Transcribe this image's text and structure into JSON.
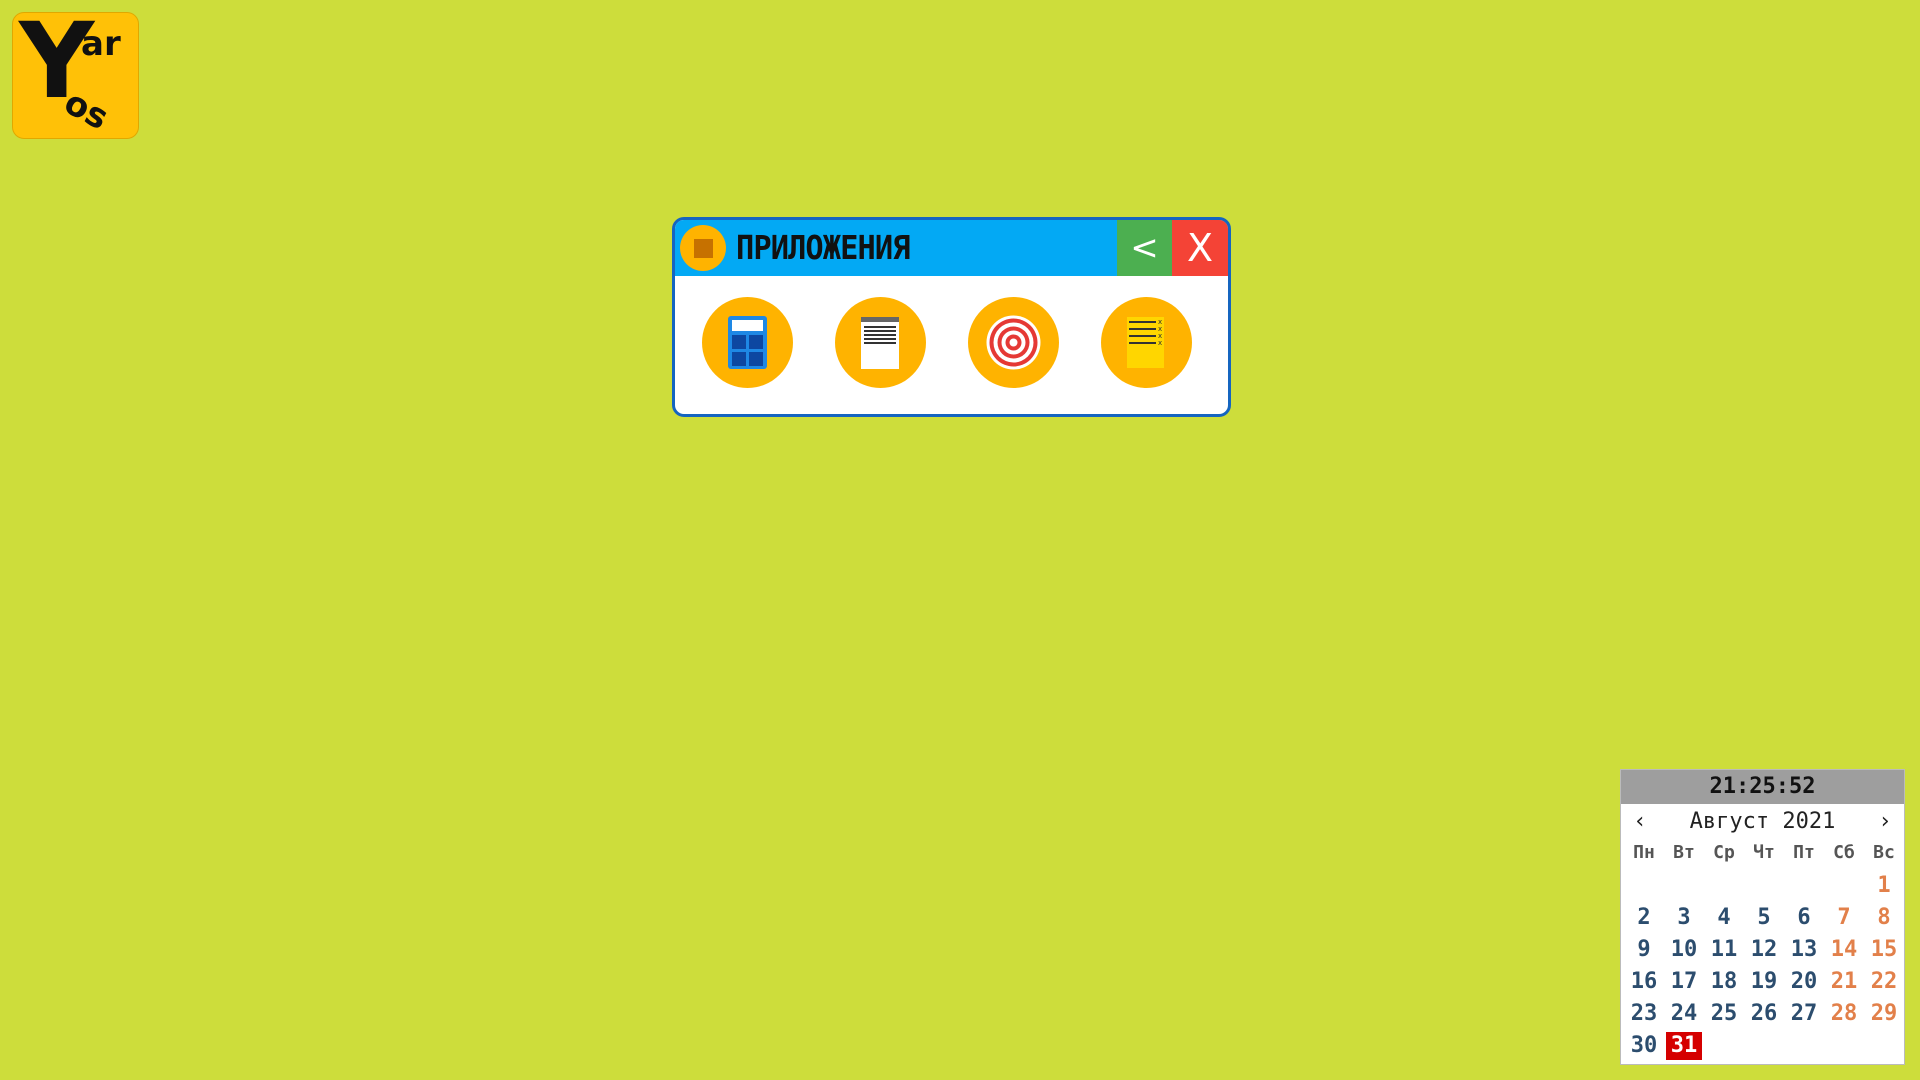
{
  "logo": {
    "big_letter": "Y",
    "small_top": "ar",
    "small_bottom": "os"
  },
  "window": {
    "title": "ПРИЛОЖЕНИЯ",
    "back_label": "<",
    "close_label": "X",
    "apps": [
      {
        "icon": "calculator-icon"
      },
      {
        "icon": "notepad-icon"
      },
      {
        "icon": "target-icon"
      },
      {
        "icon": "todo-list-icon"
      }
    ]
  },
  "widget": {
    "time": "21:25:52",
    "month_year": "Август 2021",
    "prev_label": "‹",
    "next_label": "›",
    "weekdays": [
      "Пн",
      "Вт",
      "Ср",
      "Чт",
      "Пт",
      "Сб",
      "Вс"
    ],
    "weeks": [
      [
        "",
        "",
        "",
        "",
        "",
        "",
        "1"
      ],
      [
        "2",
        "3",
        "4",
        "5",
        "6",
        "7",
        "8"
      ],
      [
        "9",
        "10",
        "11",
        "12",
        "13",
        "14",
        "15"
      ],
      [
        "16",
        "17",
        "18",
        "19",
        "20",
        "21",
        "22"
      ],
      [
        "23",
        "24",
        "25",
        "26",
        "27",
        "28",
        "29"
      ],
      [
        "30",
        "31",
        "",
        "",
        "",
        "",
        ""
      ]
    ],
    "today": "31"
  },
  "colors": {
    "desktop": "#cddd3b",
    "titlebar": "#03a9f4",
    "back_button": "#4caf50",
    "close_button": "#f44336",
    "app_circle": "#ffb300",
    "weekday_number": "#2c4d6e",
    "weekend_number": "#e2804a",
    "today_highlight": "#d50000"
  }
}
